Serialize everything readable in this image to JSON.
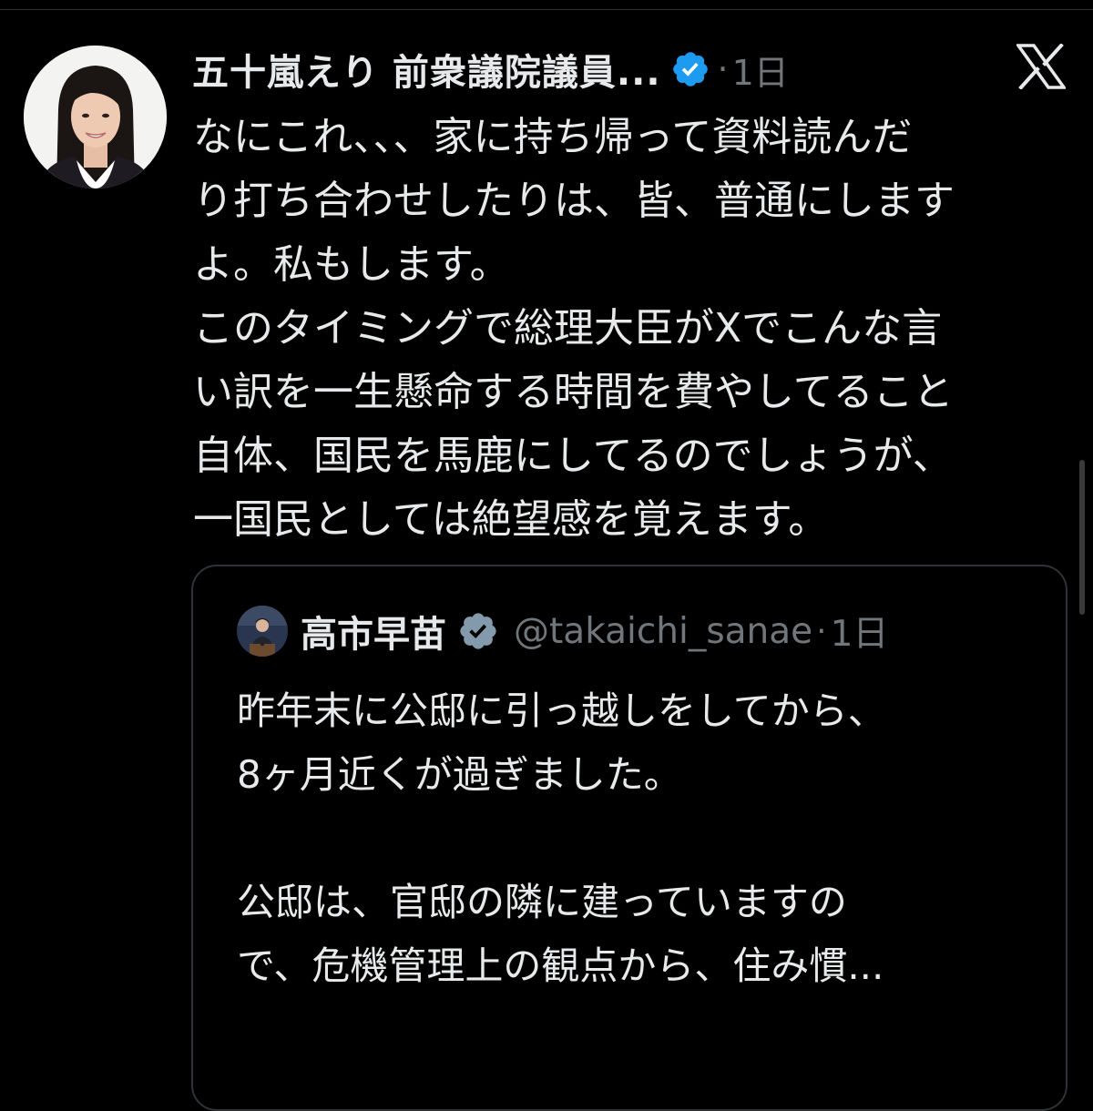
{
  "tweet": {
    "display_name": "五十嵐えり 前衆議院議員...",
    "dot": "·",
    "time": "1日",
    "text": "なにこれ、、、家に持ち帰って資料読んだ\nり打ち合わせしたりは、皆、普通にします\nよ。私もします。\nこのタイミングで総理大臣がXでこんな言\nい訳を一生懸命する時間を費やしてること\n自体、国民を馬鹿にしてるのでしょうが、\n一国民としては絶望感を覚えます。"
  },
  "quoted_tweet": {
    "display_name": "高市早苗",
    "handle": "@takaichi_sanae",
    "dot": "·",
    "time": "1日",
    "text": "昨年末に公邸に引っ越しをしてから、\n8ヶ月近くが過ぎました。\n\n公邸は、官邸の隣に建っていますの\nで、危機管理上の観点から、住み慣..."
  },
  "icons": {
    "verified": "verified-badge-icon",
    "quoted_verified": "gray-verified-badge-icon",
    "logo": "x-logo-icon"
  },
  "colors": {
    "background": "#000000",
    "text": "#e7e9ea",
    "secondary_text": "#71767b",
    "verified_blue": "#1d9bf0",
    "verified_gray": "#829aab",
    "border": "#2f3336"
  }
}
